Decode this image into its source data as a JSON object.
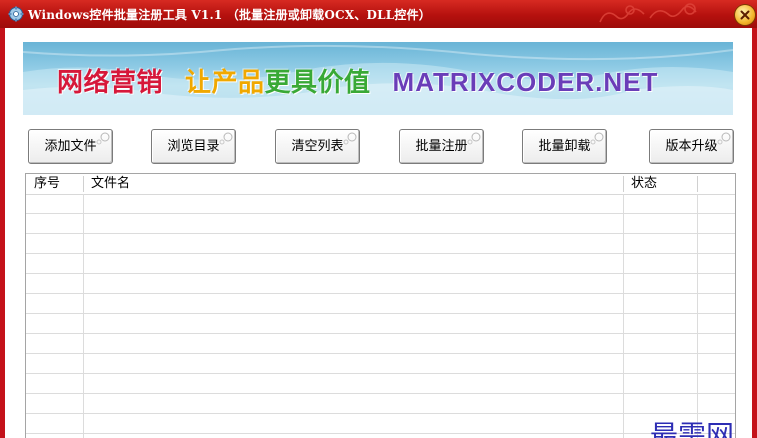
{
  "titlebar": {
    "title": "Windows控件批量注册工具 V1.1 （批量注册或卸载OCX、DLL控件）"
  },
  "banner": {
    "text1": "网络营销",
    "text2a": "让产品",
    "text2b": "更具价值",
    "text3": "MATRIXCODER.NET"
  },
  "toolbar": {
    "add_file": "添加文件",
    "browse_dir": "浏览目录",
    "clear_list": "清空列表",
    "batch_register": "批量注册",
    "batch_unregister": "批量卸载",
    "upgrade": "版本升级"
  },
  "list": {
    "columns": [
      "序号",
      "文件名",
      "状态"
    ],
    "rows": []
  },
  "watermark": "最需网",
  "colors": {
    "titlebar": "#c4121a",
    "watermark": "#2d2db4"
  }
}
